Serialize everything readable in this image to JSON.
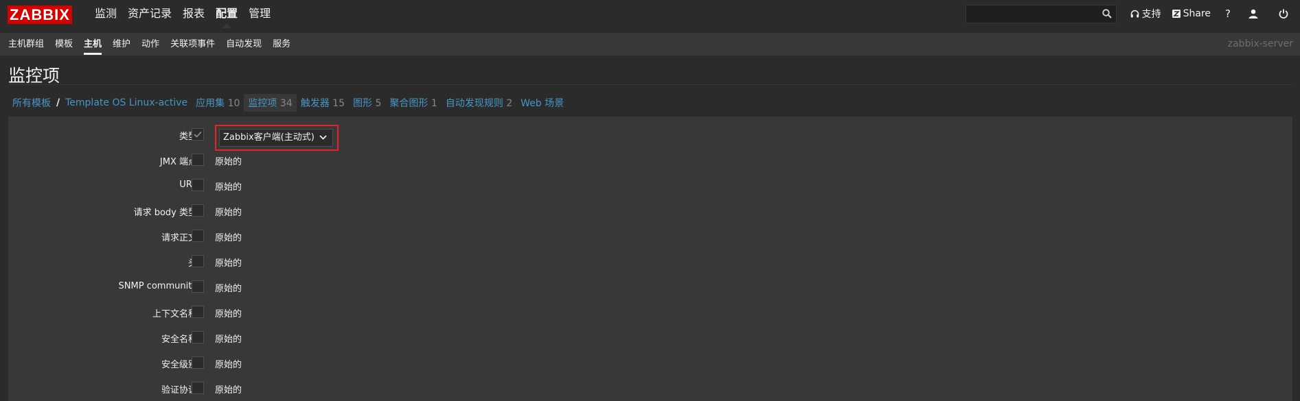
{
  "brand": {
    "logo": "ZABBIX",
    "logo_color": "#d40000"
  },
  "main_menu": [
    {
      "label": "监测"
    },
    {
      "label": "资产记录"
    },
    {
      "label": "报表"
    },
    {
      "label": "配置",
      "active": true
    },
    {
      "label": "管理"
    }
  ],
  "search": {
    "value": "",
    "placeholder": ""
  },
  "top_links": {
    "support": "支持",
    "share": "Share",
    "help": "?"
  },
  "sub_menu": [
    {
      "label": "主机群组"
    },
    {
      "label": "模板"
    },
    {
      "label": "主机",
      "active": true
    },
    {
      "label": "维护"
    },
    {
      "label": "动作"
    },
    {
      "label": "关联项事件"
    },
    {
      "label": "自动发现"
    },
    {
      "label": "服务"
    }
  ],
  "server_name": "zabbix-server",
  "page_title": "监控项",
  "breadcrumbs": {
    "all_templates": "所有模板",
    "separator": "/",
    "template": "Template OS Linux-active",
    "tabs": [
      {
        "label": "应用集",
        "count": "10"
      },
      {
        "label": "监控项",
        "count": "34",
        "active": true
      },
      {
        "label": "触发器",
        "count": "15"
      },
      {
        "label": "图形",
        "count": "5"
      },
      {
        "label": "聚合图形",
        "count": "1"
      },
      {
        "label": "自动发现规则",
        "count": "2"
      },
      {
        "label": "Web 场景",
        "count": ""
      }
    ]
  },
  "form": {
    "type_row": {
      "label": "类型",
      "checked": true,
      "selected": "Zabbix客户端(主动式)"
    },
    "rows": [
      {
        "label": "JMX 端点",
        "value": "原始的"
      },
      {
        "label": "URL",
        "value": "原始的"
      },
      {
        "label": "请求 body 类型",
        "value": "原始的"
      },
      {
        "label": "请求正文",
        "value": "原始的"
      },
      {
        "label": "头",
        "value": "原始的"
      },
      {
        "label": "SNMP community",
        "value": "原始的"
      },
      {
        "label": "上下文名称",
        "value": "原始的"
      },
      {
        "label": "安全名称",
        "value": "原始的"
      },
      {
        "label": "安全级别",
        "value": "原始的"
      },
      {
        "label": "验证协议",
        "value": "原始的"
      }
    ]
  },
  "colors": {
    "link": "#4796c4",
    "highlight_border": "#e8242b",
    "panel": "#383838",
    "background": "#2b2b2b"
  }
}
